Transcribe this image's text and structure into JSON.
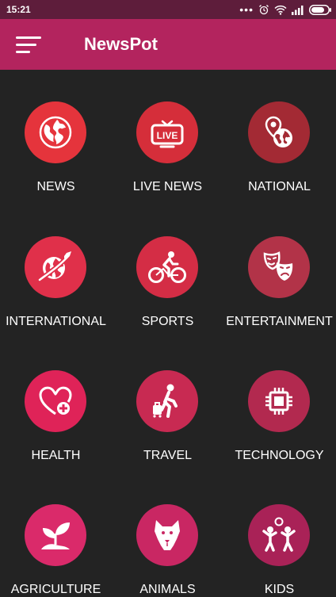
{
  "status_bar": {
    "time": "15:21",
    "signal_icon": "wifi-icon",
    "battery_icon": "battery-icon"
  },
  "app_bar": {
    "title": "NewsPot",
    "menu_icon": "hamburger-menu-icon"
  },
  "colors": {
    "status_bar": "#5e1d3b",
    "app_bar": "#b3245e",
    "background": "#232323"
  },
  "categories": [
    {
      "label": "NEWS",
      "icon": "globe-icon",
      "color": "#e5343c"
    },
    {
      "label": "LIVE NEWS",
      "icon": "live-tv-icon",
      "color": "#d52e3a"
    },
    {
      "label": "NATIONAL",
      "icon": "map-pin-globe-icon",
      "color": "#a32a34"
    },
    {
      "label": "INTERNATIONAL",
      "icon": "plane-around-globe-icon",
      "color": "#e0304a"
    },
    {
      "label": "SPORTS",
      "icon": "cyclist-icon",
      "color": "#d42d45"
    },
    {
      "label": "ENTERTAINMENT",
      "icon": "theater-masks-icon",
      "color": "#b23348"
    },
    {
      "label": "HEALTH",
      "icon": "heart-plus-icon",
      "color": "#df2358"
    },
    {
      "label": "TRAVEL",
      "icon": "traveler-luggage-icon",
      "color": "#c82a52"
    },
    {
      "label": "TECHNOLOGY",
      "icon": "chip-icon",
      "color": "#b2294f"
    },
    {
      "label": "AGRICULTURE",
      "icon": "sprout-icon",
      "color": "#da2a6a"
    },
    {
      "label": "ANIMALS",
      "icon": "dog-icon",
      "color": "#c92763"
    },
    {
      "label": "KIDS",
      "icon": "kids-playing-icon",
      "color": "#a92257"
    }
  ]
}
